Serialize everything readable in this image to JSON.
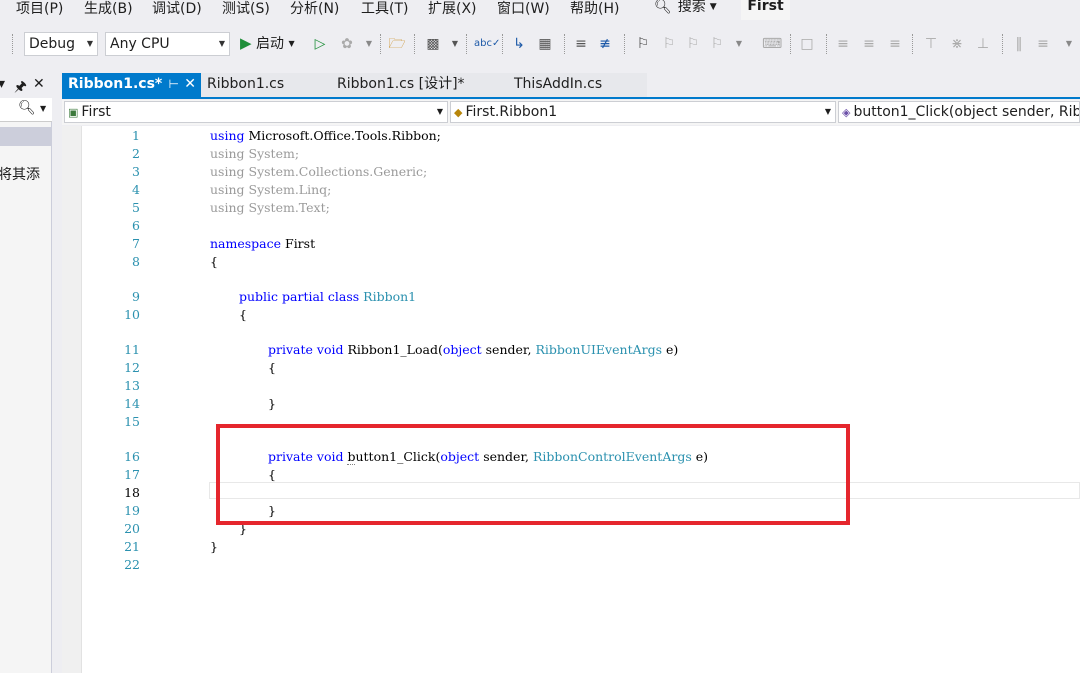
{
  "menu": {
    "items": [
      "项目(P)",
      "生成(B)",
      "调试(D)",
      "测试(S)",
      "分析(N)",
      "工具(T)",
      "扩展(X)",
      "窗口(W)",
      "帮助(H)"
    ],
    "search_label": "搜索",
    "solution_name": "First"
  },
  "toolbar": {
    "configuration": "Debug",
    "platform": "Any CPU",
    "start_label": "启动"
  },
  "left_panel": {
    "text": "将其添"
  },
  "tabs": [
    {
      "label": "Ribbon1.cs*",
      "active": true
    },
    {
      "label": "Ribbon1.cs",
      "active": false
    },
    {
      "label": "Ribbon1.cs [设计]*",
      "active": false
    },
    {
      "label": "ThisAddIn.cs",
      "active": false
    }
  ],
  "navigation": {
    "project": "First",
    "type": "First.Ribbon1",
    "member": "button1_Click(object sender, Ribb"
  },
  "code": {
    "line_numbers": [
      "1",
      "2",
      "3",
      "4",
      "5",
      "6",
      "7",
      "8",
      "9",
      "10",
      "11",
      "12",
      "13",
      "14",
      "15",
      "16",
      "17",
      "18",
      "19",
      "20",
      "21",
      "22"
    ],
    "using_kw": "using",
    "using1": "Microsoft.Office.Tools.Ribbon;",
    "using2": "System;",
    "using3": "System.Collections.Generic;",
    "using4": "System.Linq;",
    "using5": "System.Text;",
    "namespace_kw": "namespace",
    "namespace_name": "First",
    "open_brace": "{",
    "close_brace": "}",
    "class_modifiers": "public partial class",
    "class_name": "Ribbon1",
    "private_void": "private void",
    "load_method": "Ribbon1_Load(",
    "object_kw": "object",
    "sender_param": "sender,",
    "load_args_type": "RibbonUIEventArgs",
    "param_e": "e)",
    "click_method_prefix": "b",
    "click_method_rest": "utton1_Click(",
    "click_args_type": "RibbonControlEventArgs"
  },
  "colors": {
    "accent": "#007acc",
    "keyword": "#0000ff",
    "type": "#2b91af",
    "highlight": "#e5262d"
  }
}
